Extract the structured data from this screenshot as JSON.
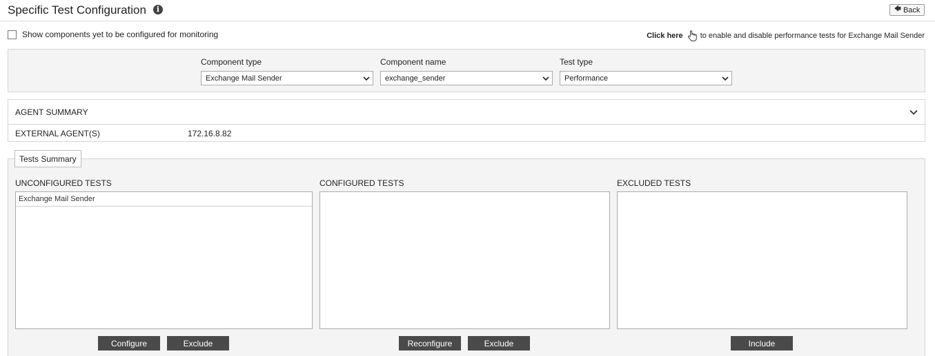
{
  "header": {
    "title": "Specific Test Configuration",
    "info_icon": "i",
    "back_label": "Back"
  },
  "options": {
    "show_unconfigured_label": "Show components yet to be configured for monitoring",
    "show_unconfigured_checked": false,
    "click_here_label": "Click here",
    "click_here_suffix": "to enable and disable performance tests for Exchange Mail Sender"
  },
  "filters": {
    "component_type": {
      "label": "Component type",
      "value": "Exchange Mail Sender"
    },
    "component_name": {
      "label": "Component name",
      "value": "exchange_sender"
    },
    "test_type": {
      "label": "Test type",
      "value": "Performance"
    }
  },
  "agent_summary": {
    "title": "AGENT SUMMARY",
    "external_agents_label": "EXTERNAL AGENT(S)",
    "external_agents_value": "172.16.8.82"
  },
  "tests_summary": {
    "tab_label": "Tests Summary",
    "unconfigured": {
      "title": "UNCONFIGURED TESTS",
      "items": [
        "Exchange Mail Sender"
      ],
      "buttons": {
        "configure": "Configure",
        "exclude": "Exclude"
      }
    },
    "configured": {
      "title": "CONFIGURED TESTS",
      "items": [],
      "buttons": {
        "reconfigure": "Reconfigure",
        "exclude": "Exclude"
      }
    },
    "excluded": {
      "title": "EXCLUDED TESTS",
      "items": [],
      "buttons": {
        "include": "Include"
      }
    }
  },
  "icons": {
    "info": "info-icon",
    "back": "arrow-left-icon",
    "hand": "hand-pointer-icon",
    "dropdown": "chevron-down-icon",
    "collapse": "chevron-down-icon"
  },
  "colors": {
    "button_bg": "#4a4a4a",
    "panel_bg": "#f4f4f4",
    "border": "#d5d5d5"
  }
}
